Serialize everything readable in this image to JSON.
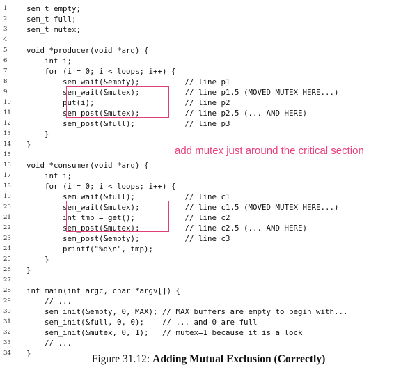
{
  "code_lines": [
    {
      "n": "1",
      "text": "sem_t empty;"
    },
    {
      "n": "2",
      "text": "sem_t full;"
    },
    {
      "n": "3",
      "text": "sem_t mutex;"
    },
    {
      "n": "4",
      "text": ""
    },
    {
      "n": "5",
      "text": "void *producer(void *arg) {"
    },
    {
      "n": "6",
      "text": "    int i;"
    },
    {
      "n": "7",
      "text": "    for (i = 0; i < loops; i++) {"
    },
    {
      "n": "8",
      "text": "        sem_wait(&empty);          // line p1"
    },
    {
      "n": "9",
      "text": "        sem_wait(&mutex);          // line p1.5 (MOVED MUTEX HERE...)"
    },
    {
      "n": "10",
      "text": "        put(i);                    // line p2"
    },
    {
      "n": "11",
      "text": "        sem_post(&mutex);          // line p2.5 (... AND HERE)"
    },
    {
      "n": "12",
      "text": "        sem_post(&full);           // line p3"
    },
    {
      "n": "13",
      "text": "    }"
    },
    {
      "n": "14",
      "text": "}"
    },
    {
      "n": "15",
      "text": ""
    },
    {
      "n": "16",
      "text": "void *consumer(void *arg) {"
    },
    {
      "n": "17",
      "text": "    int i;"
    },
    {
      "n": "18",
      "text": "    for (i = 0; i < loops; i++) {"
    },
    {
      "n": "19",
      "text": "        sem_wait(&full);           // line c1"
    },
    {
      "n": "20",
      "text": "        sem_wait(&mutex);          // line c1.5 (MOVED MUTEX HERE...)"
    },
    {
      "n": "21",
      "text": "        int tmp = get();           // line c2"
    },
    {
      "n": "22",
      "text": "        sem_post(&mutex);          // line c2.5 (... AND HERE)"
    },
    {
      "n": "23",
      "text": "        sem_post(&empty);          // line c3"
    },
    {
      "n": "24",
      "text": "        printf(\"%d\\n\", tmp);"
    },
    {
      "n": "25",
      "text": "    }"
    },
    {
      "n": "26",
      "text": "}"
    },
    {
      "n": "27",
      "text": ""
    },
    {
      "n": "28",
      "text": "int main(int argc, char *argv[]) {"
    },
    {
      "n": "29",
      "text": "    // ..."
    },
    {
      "n": "30",
      "text": "    sem_init(&empty, 0, MAX); // MAX buffers are empty to begin with..."
    },
    {
      "n": "31",
      "text": "    sem_init(&full, 0, 0);    // ... and 0 are full"
    },
    {
      "n": "32",
      "text": "    sem_init(&mutex, 0, 1);   // mutex=1 because it is a lock"
    },
    {
      "n": "33",
      "text": "    // ..."
    },
    {
      "n": "34",
      "text": "}"
    }
  ],
  "annotation": "add mutex just around the critical section",
  "annotation_color": "#e8407e",
  "caption": {
    "label": "Figure 31.12:",
    "title": "Adding Mutual Exclusion (Correctly)"
  }
}
